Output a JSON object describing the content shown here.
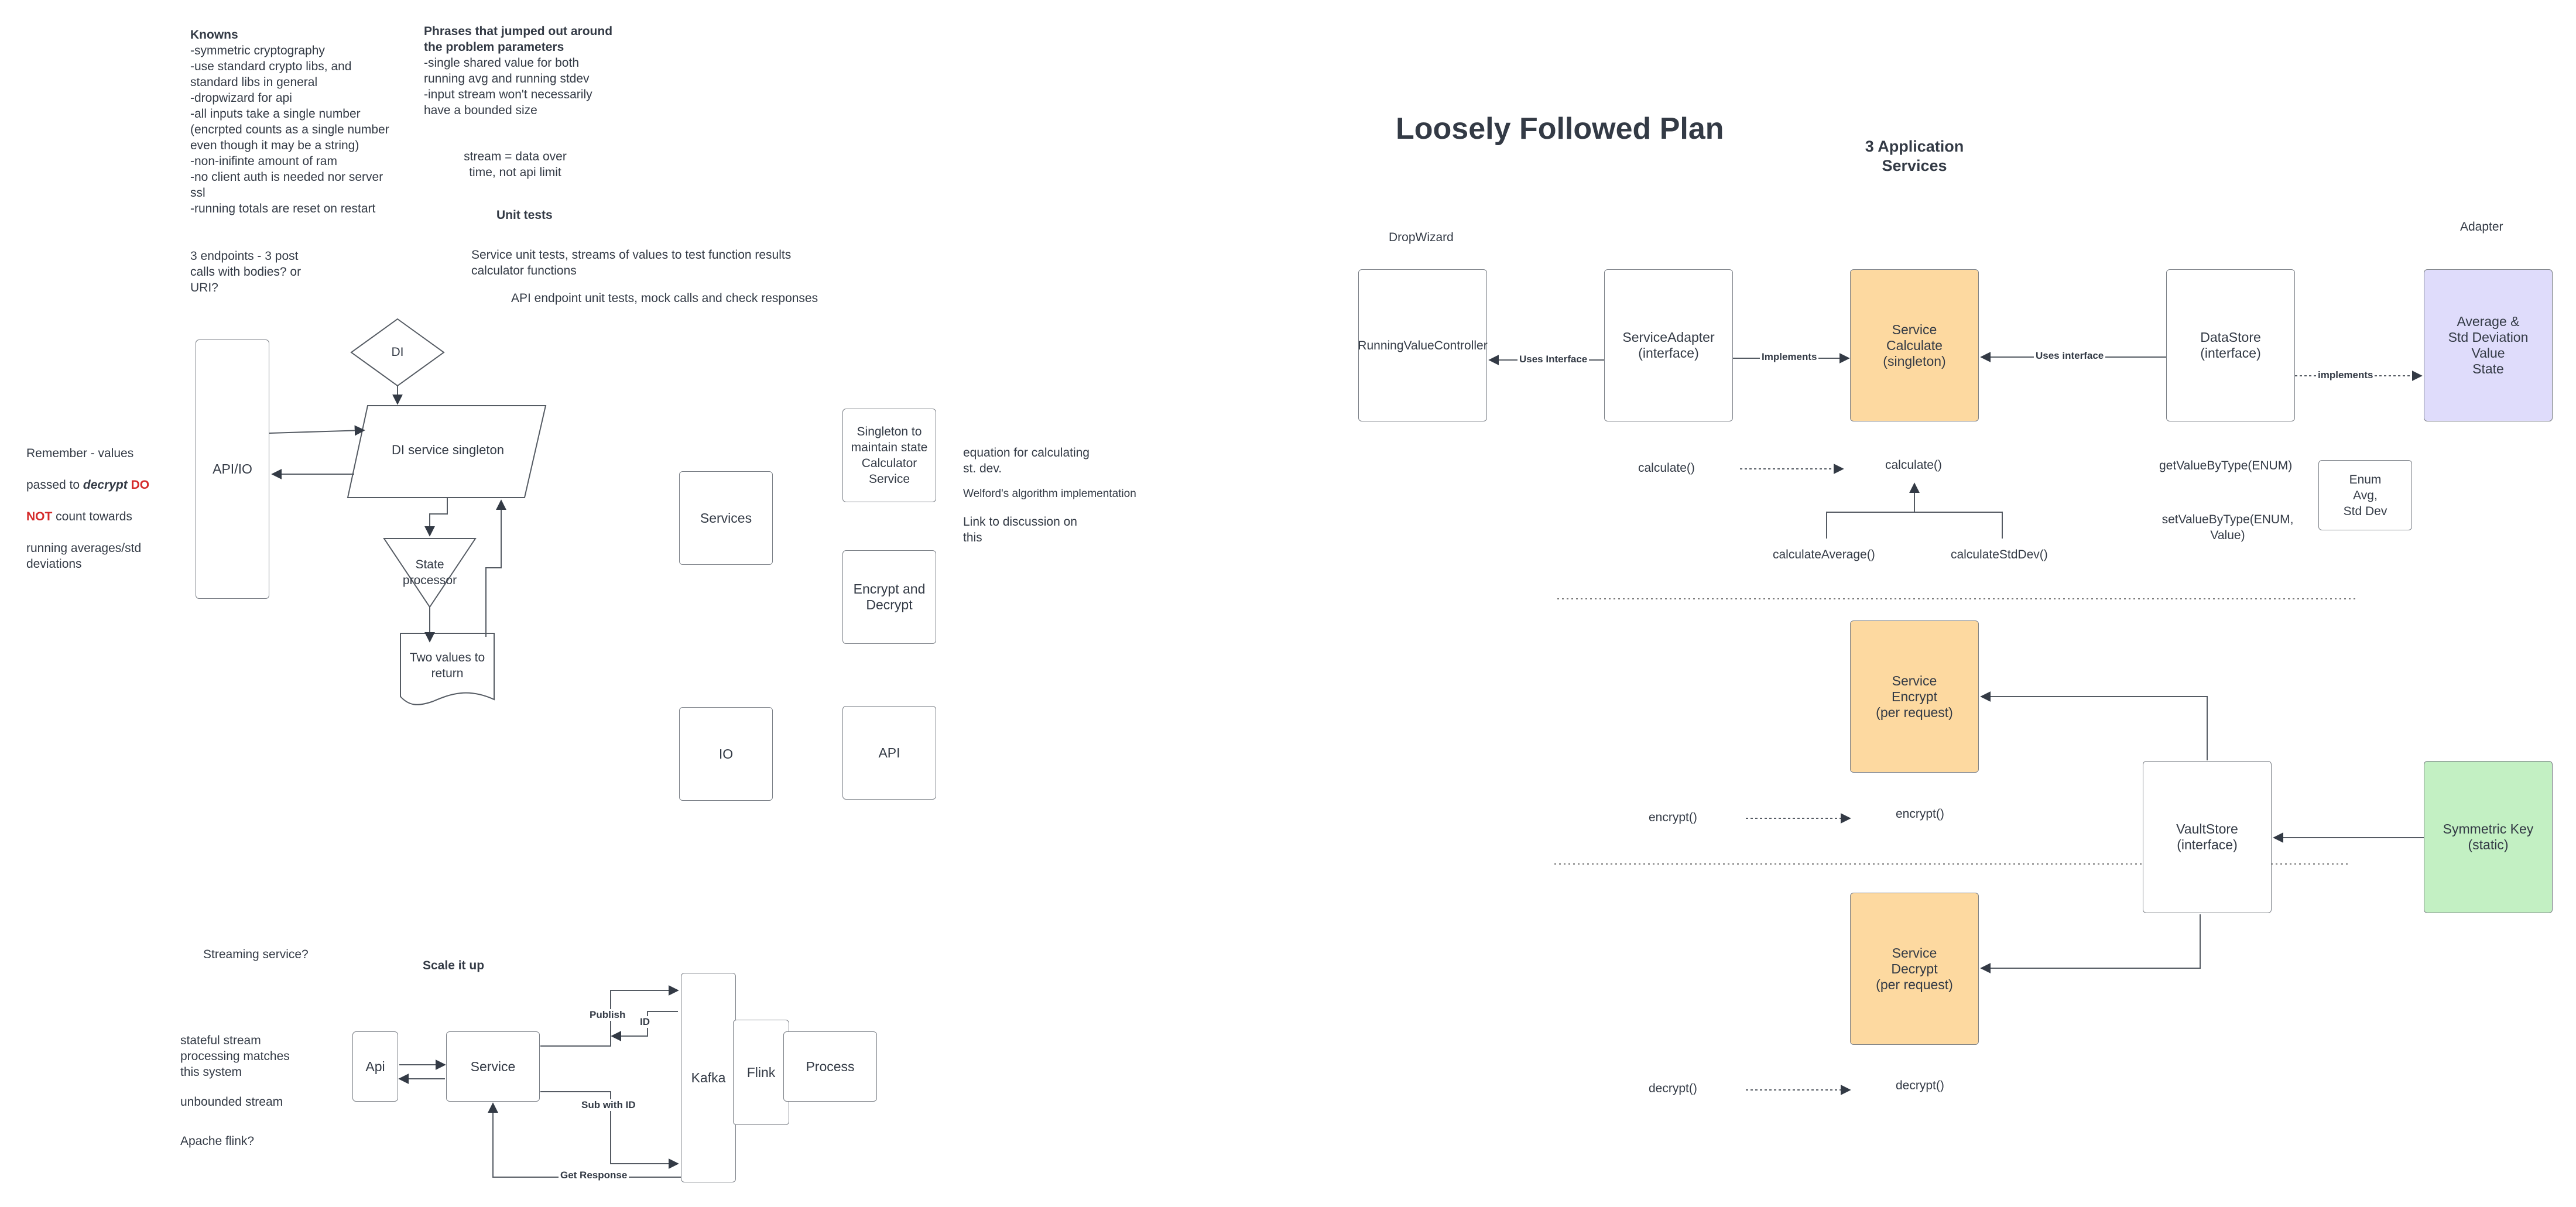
{
  "left": {
    "knowns": {
      "title": "Knowns",
      "body": "-symmetric cryptography\n-use standard crypto libs, and\nstandard libs in general\n-dropwizard for api\n-all inputs take a single number\n(encrpted counts as a single number\neven though it may be a string)\n-non-inifinte amount of ram\n-no client auth is needed nor server\nssl\n-running totals are reset on restart"
    },
    "phrases": {
      "title": "Phrases that jumped out around\nthe problem parameters",
      "body": "-single shared value for both\nrunning avg and running stdev\n-input stream won't necessarily\nhave a bounded size"
    },
    "stream_note": "stream = data over\ntime, not api limit",
    "unit_tests_title": "Unit tests",
    "unit_test_1": "Service unit tests, streams of values to test function results\ncalculator functions",
    "unit_test_2": "API endpoint unit tests, mock calls and check responses",
    "endpoints_note": "3 endpoints - 3 post\ncalls with bodies? or\nURI?",
    "remember": {
      "line1": "Remember - values",
      "line2_pre": "passed to ",
      "line2_em": "decrypt",
      "line2_red": " DO",
      "line3_red": "NOT",
      "line3_post": " count towards",
      "line4": "running averages/std\ndeviations"
    },
    "flow": {
      "api_io": "API/IO",
      "di": "DI",
      "di_service": "DI service singleton",
      "state_processor": "State\nprocessor",
      "two_values": "Two values to\nreturn"
    },
    "blocks": {
      "services": "Services",
      "singleton": "Singleton to\nmaintain state\nCalculator\nService",
      "encrypt_decrypt": "Encrypt and\nDecrypt",
      "io": "IO",
      "api": "API"
    },
    "equation_note": "equation for calculating\nst. dev.",
    "welford": "Welford's algorithm implementation",
    "link_note": "Link to discussion on\nthis",
    "streaming": {
      "question": "Streaming service?",
      "scale_title": "Scale it up",
      "stateful": "stateful stream\nprocessing matches\nthis system",
      "unbounded": "unbounded stream",
      "apache": "Apache flink?",
      "api": "Api",
      "service": "Service",
      "kafka": "Kafka",
      "flink": "Flink",
      "process": "Process",
      "publish": "Publish",
      "id": "ID",
      "sub_with_id": "Sub with ID",
      "get_response": "Get Response"
    }
  },
  "right": {
    "title": "Loosely Followed Plan",
    "subtitle": "3  Application\nServices",
    "dropwizard": "DropWizard",
    "adapter": "Adapter",
    "running_controller": "RunningValueController",
    "service_adapter": "ServiceAdapter\n(interface)",
    "service_calculate": "Service\nCalculate\n(singleton)",
    "data_store": "DataStore\n(interface)",
    "avg_std": "Average &\nStd Deviation\nValue\nState",
    "uses_interface_1": "Uses Interface",
    "implements_1": "Implements",
    "uses_interface_2": "Uses interface",
    "implements_2": "implements",
    "calculate_left": "calculate()",
    "calculate_right": "calculate()",
    "calculate_average": "calculateAverage()",
    "calculate_stddev": "calculateStdDev()",
    "get_value": "getValueByType(ENUM)",
    "set_value": "setValueByType(ENUM,\nValue)",
    "enum_box": "Enum\nAvg,\nStd Dev",
    "service_encrypt": "Service\nEncrypt\n(per request)",
    "vault_store": "VaultStore\n(interface)",
    "symmetric_key": "Symmetric Key\n(static)",
    "encrypt_left": "encrypt()",
    "encrypt_right": "encrypt()",
    "service_decrypt": "Service\nDecrypt\n(per request)",
    "decrypt_left": "decrypt()",
    "decrypt_right": "decrypt()"
  },
  "colors": {
    "orange": "#fdd9a0",
    "purple": "#dfdcfb",
    "green": "#c3f0c3",
    "red": "#d42a2a",
    "line": "#555b63"
  }
}
